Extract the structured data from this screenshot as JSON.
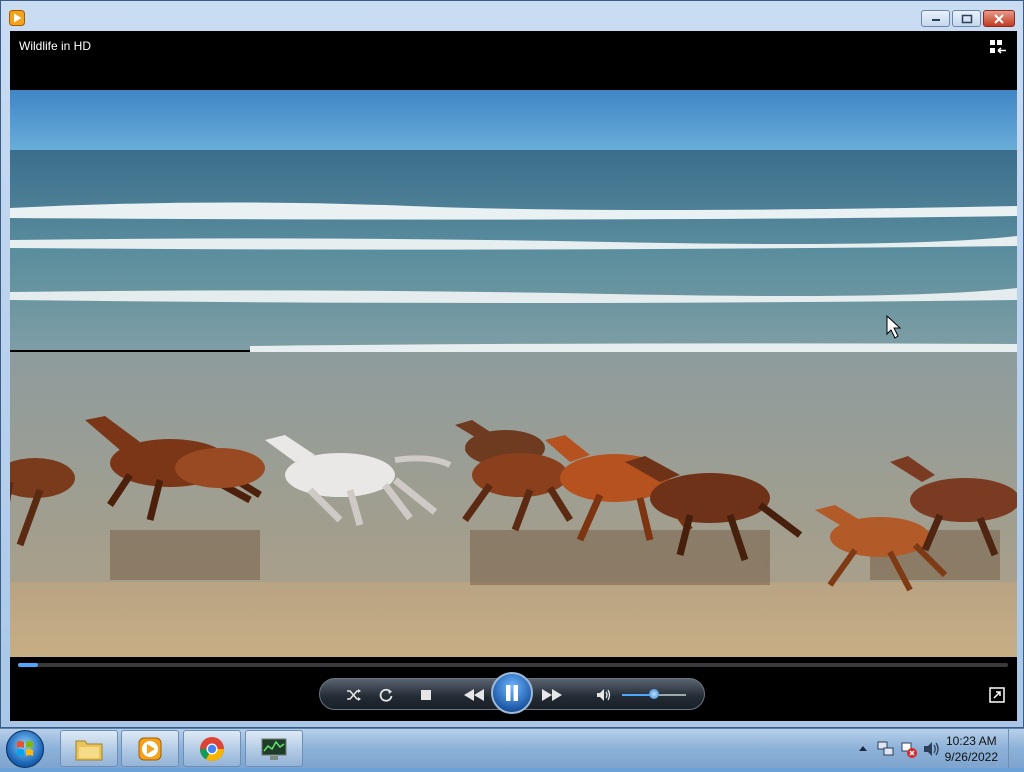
{
  "window": {
    "video_title": "Wildlife in HD"
  },
  "player": {
    "seek_progress_percent": 2,
    "volume_percent": 50,
    "icons": {
      "shuffle": "shuffle-icon",
      "repeat": "repeat-icon",
      "stop": "stop-icon",
      "previous": "rewind-icon",
      "play_pause": "pause-icon",
      "next": "fast-forward-icon",
      "mute": "speaker-icon",
      "fullscreen": "fullscreen-icon",
      "switch_to_library": "switch-to-library-icon"
    }
  },
  "taskbar": {
    "apps": [
      "file-explorer-icon",
      "media-player-icon",
      "chrome-icon",
      "system-monitor-icon"
    ],
    "clock": {
      "time": "10:23 AM",
      "date": "9/26/2022"
    }
  },
  "colors": {
    "accent": "#4fa6ff",
    "frame": "#a9c6e8",
    "close": "#c23b22"
  }
}
